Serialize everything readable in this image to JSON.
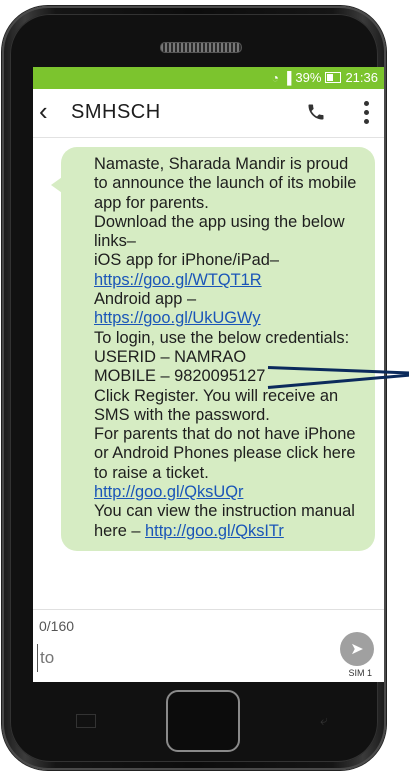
{
  "status_bar": {
    "battery": "39%",
    "time": "21:36",
    "bg_color": "#7cc42e"
  },
  "app_bar": {
    "title": "SMHSCH",
    "back_icon": "back-arrow-icon",
    "call_icon": "phone-call-icon",
    "menu_icon": "overflow-menu-icon"
  },
  "message": {
    "lines": [
      "Namaste, Sharada Mandir is proud",
      "to announce the launch of its mobile",
      "app for parents.",
      "Download the app using the below",
      "links–",
      "iOS app for iPhone/iPad–",
      "Android app –",
      "To login, use the below credentials:",
      "USERID – NAMRAO",
      "MOBILE – 9820095127",
      "Click Register. You will receive an",
      "SMS with the password.",
      "For parents that do not have iPhone",
      "or Android Phones please click here",
      "to raise a ticket.",
      "You can view the instruction manual",
      "here – "
    ],
    "ios_link": "https://goo.gl/WTQT1R",
    "android_link": "https://goo.gl/UkUGWy",
    "ticket_link": "http://goo.gl/QksUQr",
    "manual_link": "http://goo.gl/QksITr",
    "bubble_color": "#d6ecc3"
  },
  "compose": {
    "counter": "0/160",
    "placeholder": "to",
    "sim_label": "SIM 1",
    "send_icon": "send-icon"
  }
}
